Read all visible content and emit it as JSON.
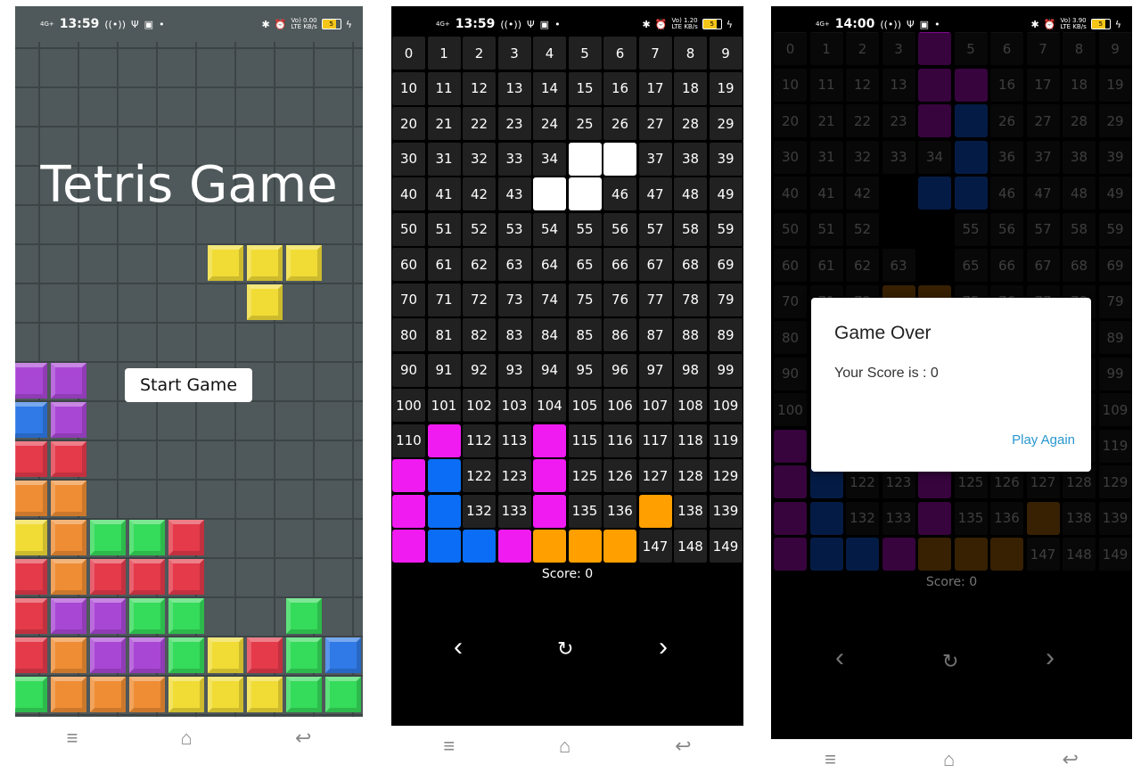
{
  "status1": {
    "network": "4G+",
    "time": "13:59",
    "speed": "0.00",
    "battery": "5"
  },
  "status2": {
    "network": "4G+",
    "time": "13:59",
    "speed": "1.20",
    "battery": "5"
  },
  "status3": {
    "network": "4G+",
    "time": "14:00",
    "speed": "3.90",
    "battery": "5"
  },
  "status_common": {
    "lte": "LTE",
    "kbs": "KB/s",
    "volte": "Vo)",
    "hotspot_icon": "((•))",
    "usb_icon": "Ψ",
    "app_icon": "▣",
    "dot_icon": "•",
    "bt_icon": "✱",
    "alarm_icon": "⏰",
    "charge_icon": "ϟ"
  },
  "start_screen": {
    "title": "Tetris Game",
    "button": "Start Game"
  },
  "game": {
    "score_label": "Score: ",
    "score": "0",
    "left_icon": "‹",
    "rotate_icon": "↻",
    "right_icon": "›"
  },
  "dialog": {
    "title": "Game Over",
    "message": "Your Score is : 0",
    "button": "Play Again"
  },
  "nav": {
    "menu_icon": "≡",
    "home_icon": "⌂",
    "back_icon": "↩"
  },
  "colors": {
    "yellow": "#f1dc36",
    "purple": "#a947d5",
    "blue": "#2f7ae6",
    "red": "#e43a4a",
    "orange": "#ef8d34",
    "green": "#35db5a",
    "magenta": "#f01bf0",
    "piece_blue": "#0b6df5",
    "piece_orange": "#ff9f00",
    "white": "#ffffff",
    "cell": "#212121",
    "link": "#2a97cf"
  },
  "board2": {
    "pieces": {
      "35": "white",
      "36": "white",
      "44": "white",
      "45": "white",
      "111": "magenta",
      "114": "magenta",
      "120": "magenta",
      "121": "piece_blue",
      "124": "magenta",
      "130": "magenta",
      "131": "piece_blue",
      "134": "magenta",
      "137": "piece_orange",
      "140": "magenta",
      "141": "piece_blue",
      "142": "piece_blue",
      "143": "magenta",
      "144": "piece_orange",
      "145": "piece_orange",
      "146": "piece_orange"
    }
  },
  "board3": {
    "pieces": {
      "4": "purple3",
      "14": "purple3",
      "15": "purple3",
      "24": "purple3",
      "25": "blue3",
      "35": "blue3",
      "44": "blue3",
      "45": "blue3",
      "73": "orange3",
      "74": "orange3",
      "110": "purple3",
      "120": "purple3",
      "121": "blue3",
      "124": "purple3",
      "130": "purple3",
      "131": "blue3",
      "134": "purple3",
      "137": "orange3",
      "140": "purple3",
      "141": "blue3",
      "142": "blue3",
      "143": "purple3",
      "144": "orange3",
      "145": "orange3",
      "146": "orange3"
    },
    "empty": [
      "43",
      "53",
      "54",
      "64"
    ]
  }
}
